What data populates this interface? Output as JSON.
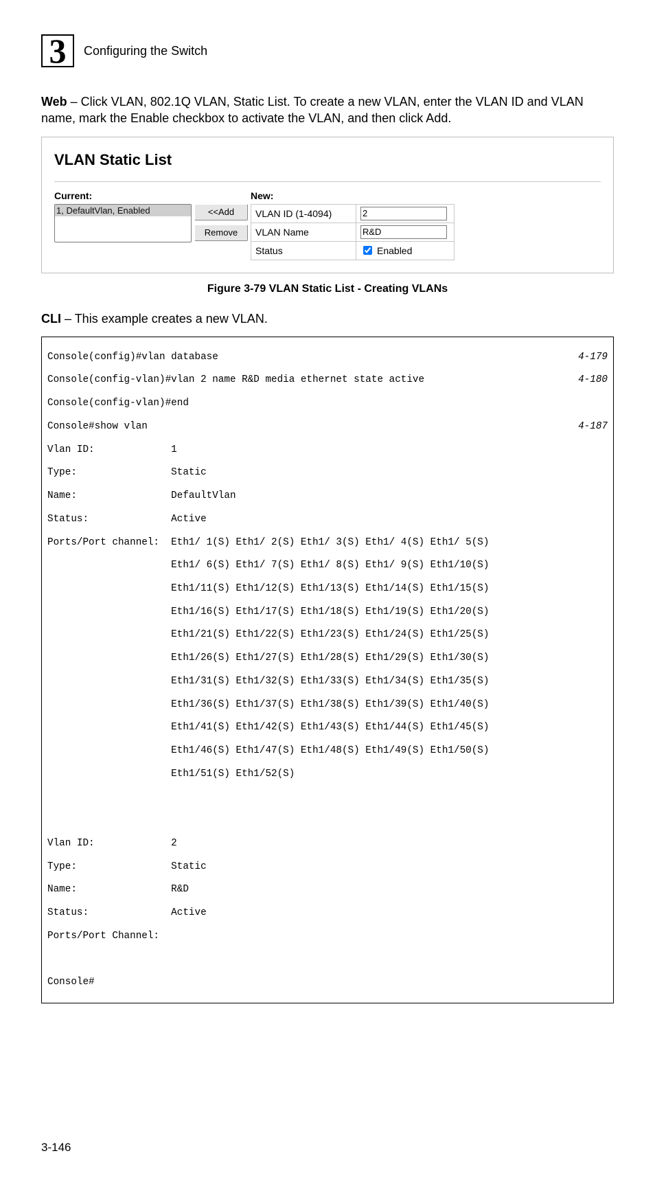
{
  "header": {
    "chapter_number": "3",
    "chapter_title": "Configuring the Switch"
  },
  "intro": {
    "web_bold": "Web",
    "web_text": " – Click VLAN, 802.1Q VLAN, Static List. To create a new VLAN, enter the VLAN ID and VLAN name, mark the Enable checkbox to activate the VLAN, and then click Add."
  },
  "panel": {
    "title": "VLAN Static List",
    "current_label": "Current:",
    "current_item": "1, DefaultVlan, Enabled",
    "btn_add": "<<Add",
    "btn_remove": "Remove",
    "new_label": "New:",
    "row_vlanid_label": "VLAN ID (1-4094)",
    "row_vlanid_value": "2",
    "row_vlanname_label": "VLAN Name",
    "row_vlanname_value": "R&D",
    "row_status_label": "Status",
    "row_status_chklabel": "Enabled"
  },
  "figure_caption": "Figure 3-79  VLAN Static List - Creating VLANs",
  "cli_intro_bold": "CLI",
  "cli_intro_text": " – This example creates a new VLAN.",
  "cli": {
    "l01": "Console(config)#vlan database",
    "r01": "4-179",
    "l02": "Console(config-vlan)#vlan 2 name R&D media ethernet state active",
    "r02": "4-180",
    "l03": "Console(config-vlan)#end",
    "l04": "Console#show vlan",
    "r04": "4-187",
    "l05": "Vlan ID:             1",
    "l06": "Type:                Static",
    "l07": "Name:                DefaultVlan",
    "l08": "Status:              Active",
    "l09": "Ports/Port channel:  Eth1/ 1(S) Eth1/ 2(S) Eth1/ 3(S) Eth1/ 4(S) Eth1/ 5(S)",
    "l10": "                     Eth1/ 6(S) Eth1/ 7(S) Eth1/ 8(S) Eth1/ 9(S) Eth1/10(S)",
    "l11": "                     Eth1/11(S) Eth1/12(S) Eth1/13(S) Eth1/14(S) Eth1/15(S)",
    "l12": "                     Eth1/16(S) Eth1/17(S) Eth1/18(S) Eth1/19(S) Eth1/20(S)",
    "l13": "                     Eth1/21(S) Eth1/22(S) Eth1/23(S) Eth1/24(S) Eth1/25(S)",
    "l14": "                     Eth1/26(S) Eth1/27(S) Eth1/28(S) Eth1/29(S) Eth1/30(S)",
    "l15": "                     Eth1/31(S) Eth1/32(S) Eth1/33(S) Eth1/34(S) Eth1/35(S)",
    "l16": "                     Eth1/36(S) Eth1/37(S) Eth1/38(S) Eth1/39(S) Eth1/40(S)",
    "l17": "                     Eth1/41(S) Eth1/42(S) Eth1/43(S) Eth1/44(S) Eth1/45(S)",
    "l18": "                     Eth1/46(S) Eth1/47(S) Eth1/48(S) Eth1/49(S) Eth1/50(S)",
    "l19": "                     Eth1/51(S) Eth1/52(S)",
    "l20": "",
    "l21": "",
    "l22": "Vlan ID:             2",
    "l23": "Type:                Static",
    "l24": "Name:                R&D",
    "l25": "Status:              Active",
    "l26": "Ports/Port Channel:",
    "l27": "",
    "l28": "Console#"
  },
  "page_number": "3-146"
}
